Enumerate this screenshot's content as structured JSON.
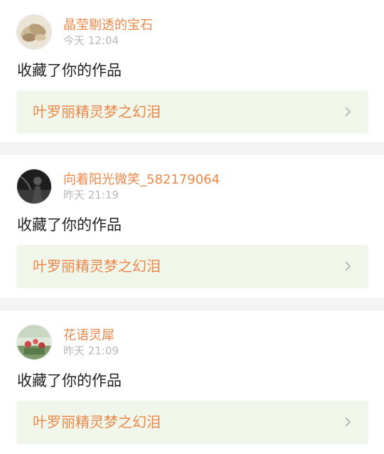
{
  "feed": [
    {
      "username": "晶莹剔透的宝石",
      "time": "今天 12:04",
      "action": "收藏了你的作品",
      "work_title": "叶罗丽精灵梦之幻泪",
      "avatar_icon": "gem-photo-avatar"
    },
    {
      "username": "向着阳光微笑_582179064",
      "time": "昨天 21:19",
      "action": "收藏了你的作品",
      "work_title": "叶罗丽精灵梦之幻泪",
      "avatar_icon": "dark-figure-avatar"
    },
    {
      "username": "花语灵犀",
      "time": "昨天 21:09",
      "action": "收藏了你的作品",
      "work_title": "叶罗丽精灵梦之幻泪",
      "avatar_icon": "flower-photo-avatar"
    }
  ],
  "colors": {
    "accent": "#e9884a",
    "link_bg": "#f1f6ea",
    "muted": "#b8b8b8",
    "separator": "#f4f4f4"
  }
}
